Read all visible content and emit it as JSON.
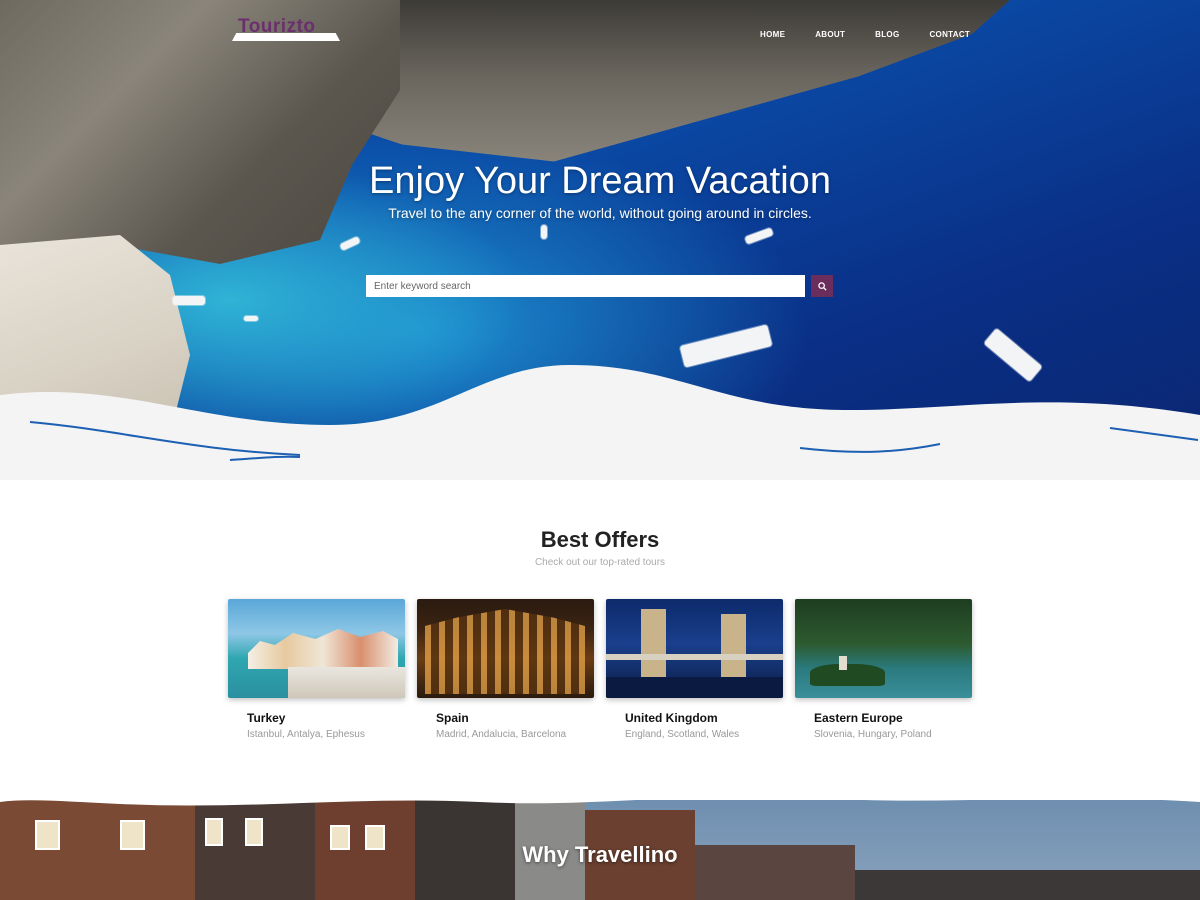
{
  "brand": {
    "logo_text": "Tourizto",
    "accent": "#6b2d5b"
  },
  "nav": {
    "items": [
      {
        "label": "HOME"
      },
      {
        "label": "ABOUT"
      },
      {
        "label": "BLOG"
      },
      {
        "label": "CONTACT"
      }
    ]
  },
  "hero": {
    "title": "Enjoy Your Dream Vacation",
    "subtitle": "Travel to the any corner of the world, without going around in circles.",
    "search_placeholder": "Enter keyword search",
    "search_icon": "search-icon"
  },
  "offers": {
    "title": "Best Offers",
    "subtitle": "Check out our top-rated tours",
    "cards": [
      {
        "title": "Turkey",
        "desc": "Istanbul, Antalya, Ephesus"
      },
      {
        "title": "Spain",
        "desc": "Madrid, Andalucia, Barcelona"
      },
      {
        "title": "United Kingdom",
        "desc": "England, Scotland, Wales"
      },
      {
        "title": "Eastern Europe",
        "desc": "Slovenia, Hungary, Poland"
      }
    ]
  },
  "why": {
    "title": "Why Travellino"
  }
}
